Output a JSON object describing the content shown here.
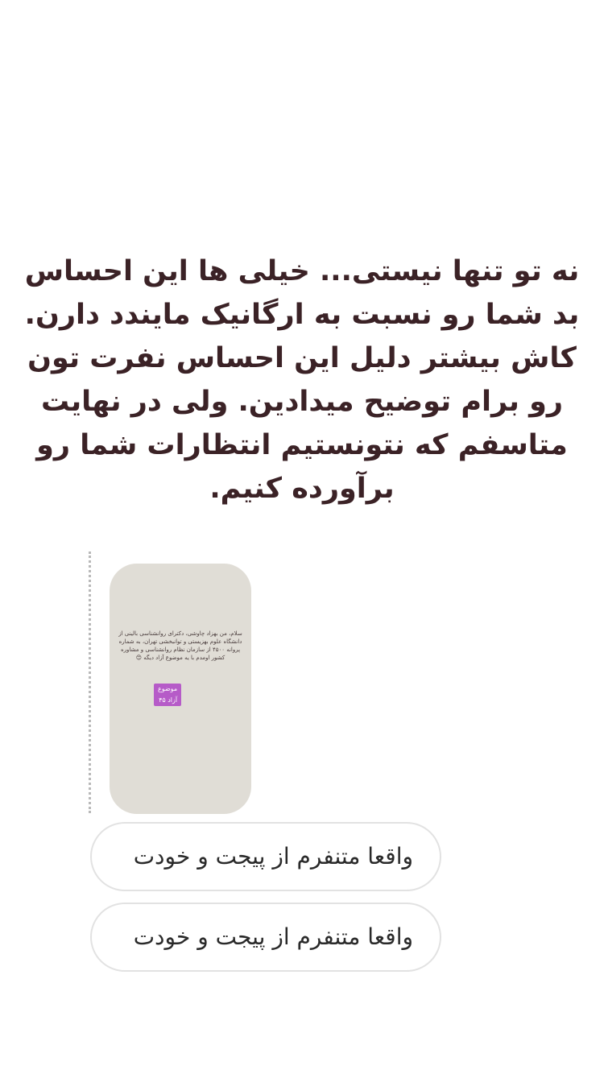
{
  "story": {
    "text": "نه تو تنها نیستی... خیلی ها این احساس بد شما رو نسبت به ارگانیک مایندد دارن. کاش بیشتر دلیل این احساس نفرت تون رو برام توضیح میدادین. ولی در نهایت متاسفم که نتونستیم انتظارات شما رو برآورده کنیم."
  },
  "replied_story": {
    "text": "سلام، من بهزاد چاوشی، دکترای روانشناسی بالینی از دانشگاه علوم بهزیستی و توانبخشی تهران، به شماره پروانه ۴۵۰۰ از سازمان نظام روانشناسی و مشاوره کشور اومدم با یه موضوع آزاد دیگه 😊",
    "badge": "موضوع آزاد ۴۵"
  },
  "messages": [
    {
      "text": "واقعا متنفرم از پیجت و خودت"
    },
    {
      "text": "واقعا متنفرم از پیجت و خودت"
    }
  ],
  "colors": {
    "story_text": "#3b2226",
    "thumb_background": "#e0ddd6",
    "badge": "#b65bc8",
    "bubble_border": "#e2e2e2"
  }
}
